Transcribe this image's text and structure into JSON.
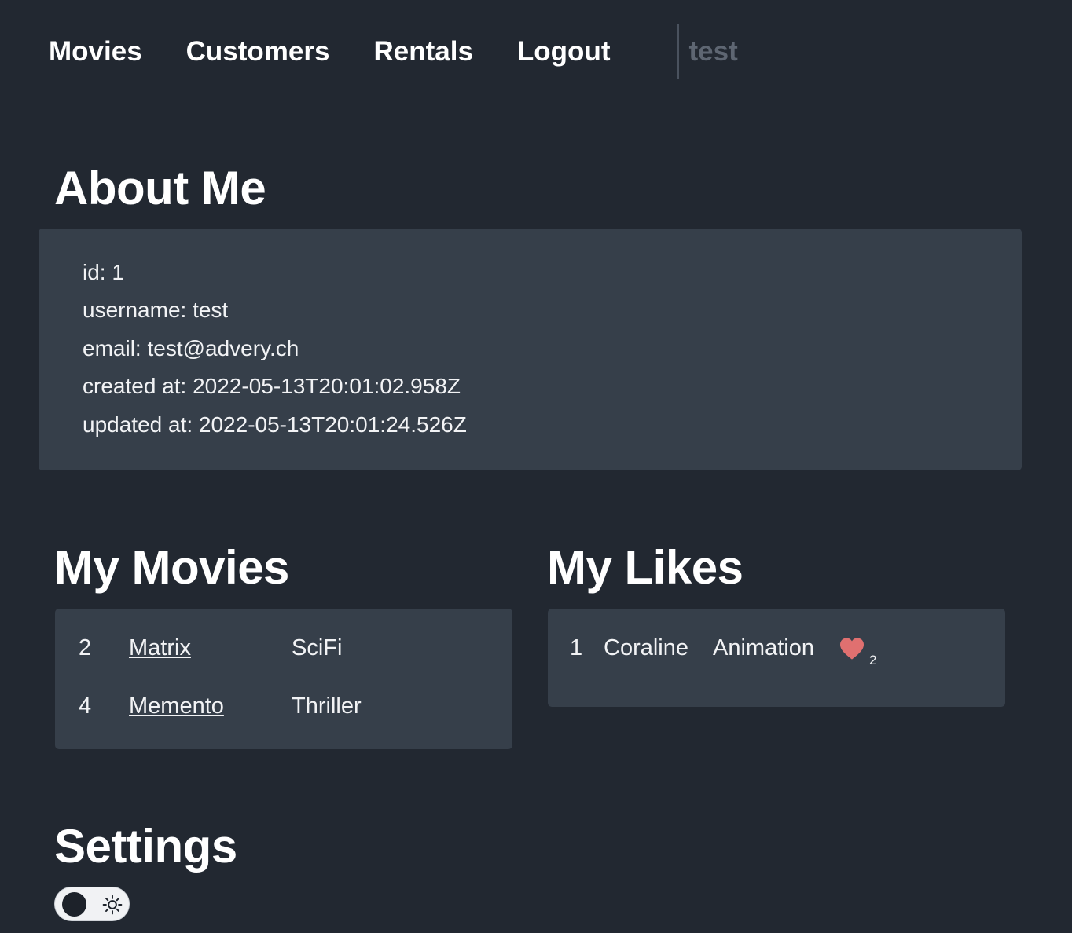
{
  "nav": {
    "items": [
      {
        "label": "Movies"
      },
      {
        "label": "Customers"
      },
      {
        "label": "Rentals"
      },
      {
        "label": "Logout"
      }
    ],
    "current_user": "test"
  },
  "about": {
    "title": "About Me",
    "lines": [
      "id: 1",
      "username: test",
      "email: test@advery.ch",
      "created at: 2022-05-13T20:01:02.958Z",
      "updated at: 2022-05-13T20:01:24.526Z"
    ]
  },
  "my_movies": {
    "title": "My Movies",
    "rows": [
      {
        "id": "2",
        "title": "Matrix",
        "genre": "SciFi"
      },
      {
        "id": "4",
        "title": "Memento",
        "genre": "Thriller"
      }
    ]
  },
  "my_likes": {
    "title": "My Likes",
    "rows": [
      {
        "id": "1",
        "title": "Coraline",
        "genre": "Animation",
        "likes": "2",
        "icon": "heart-icon"
      }
    ]
  },
  "settings": {
    "title": "Settings",
    "theme_toggle": {
      "state": "off",
      "icon": "sun-icon"
    }
  },
  "colors": {
    "background": "#222831",
    "panel": "#363f4a",
    "heart": "#e07070",
    "muted_text": "#5e6672"
  }
}
